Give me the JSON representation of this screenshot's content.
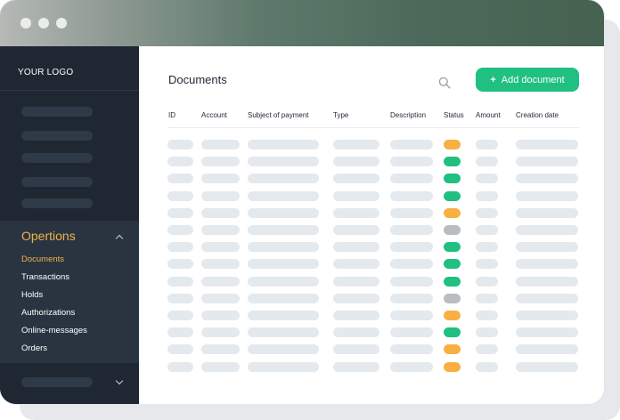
{
  "window": {
    "titlebar_colors": [
      "#b6b9b6",
      "#46614f"
    ]
  },
  "sidebar": {
    "logo": "YOUR LOGO",
    "section": {
      "title": "Opertions",
      "items": [
        {
          "label": "Documents",
          "active": true
        },
        {
          "label": "Transactions",
          "active": false
        },
        {
          "label": "Holds",
          "active": false
        },
        {
          "label": "Authorizations",
          "active": false
        },
        {
          "label": "Online-messages",
          "active": false
        },
        {
          "label": "Orders",
          "active": false
        }
      ]
    }
  },
  "main": {
    "title": "Documents",
    "add_button": "Add document",
    "table": {
      "columns": [
        "ID",
        "Account",
        "Subject of payment",
        "Type",
        "Description",
        "Status",
        "Amount",
        "Creation date"
      ],
      "row_statuses": [
        "pending",
        "success",
        "success",
        "success",
        "pending",
        "neutral",
        "success",
        "success",
        "success",
        "neutral",
        "pending",
        "success",
        "pending",
        "pending"
      ]
    }
  },
  "colors": {
    "accent": "#1fc080",
    "highlight": "#f0b24b",
    "sidebar_bg": "#1f2733",
    "status": {
      "success": "#1fc080",
      "pending": "#f8b043",
      "neutral": "#b9bcc0"
    }
  },
  "icons": {
    "search": "search-icon",
    "add": "plus-icon",
    "expand": "chevron-up-icon",
    "collapse": "chevron-down-icon"
  }
}
